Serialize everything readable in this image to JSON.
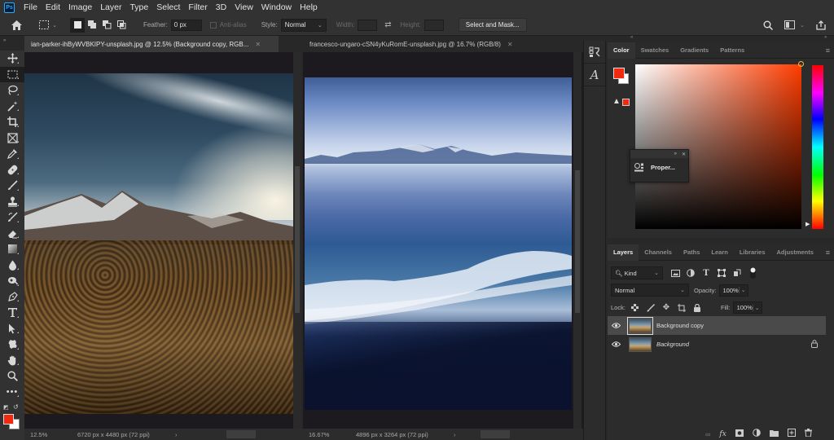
{
  "app": {
    "logo": "Ps"
  },
  "menubar": {
    "items": [
      "File",
      "Edit",
      "Image",
      "Layer",
      "Type",
      "Select",
      "Filter",
      "3D",
      "View",
      "Window",
      "Help"
    ]
  },
  "options": {
    "feather_label": "Feather:",
    "feather_value": "0 px",
    "antialias_label": "Anti-alias",
    "style_label": "Style:",
    "style_value": "Normal",
    "width_label": "Width:",
    "height_label": "Height:",
    "select_mask_label": "Select and Mask..."
  },
  "documents": [
    {
      "tab_title": "ian-parker-ihByWVBKIPY-unsplash.jpg @ 12.5% (Background copy, RGB...",
      "zoom": "12.5%",
      "info": "6720 px x 4480 px (72 ppi)",
      "active": true
    },
    {
      "tab_title": "francesco-ungaro-cSN4yKuRomE-unsplash.jpg @ 16.7% (RGB/8)",
      "zoom": "16.67%",
      "info": "4896 px x 3264 px (72 ppi)",
      "active": false
    }
  ],
  "color_panel": {
    "tabs": [
      "Color",
      "Swatches",
      "Gradients",
      "Patterns"
    ],
    "active_tab": "Color",
    "foreground": "#f02a10",
    "background": "#ffffff",
    "hue_accent": "#ff3c00"
  },
  "properties_popup": {
    "label": "Proper..."
  },
  "layers_panel": {
    "tabs": [
      "Layers",
      "Channels",
      "Paths",
      "Learn",
      "Libraries",
      "Adjustments"
    ],
    "active_tab": "Layers",
    "filter_kind": "Kind",
    "blend_mode": "Normal",
    "opacity_label": "Opacity:",
    "opacity_value": "100%",
    "lock_label": "Lock:",
    "fill_label": "Fill:",
    "fill_value": "100%",
    "layers": [
      {
        "name": "Background copy",
        "selected": true,
        "locked": false
      },
      {
        "name": "Background",
        "selected": false,
        "locked": true
      }
    ]
  },
  "toolbar": {
    "foreground": "#f02a10",
    "background": "#ffffff"
  }
}
